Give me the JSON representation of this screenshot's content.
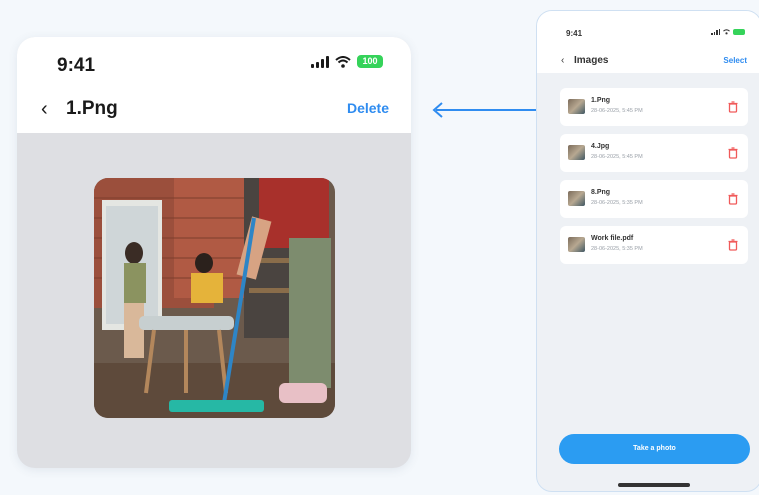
{
  "detail": {
    "time": "9:41",
    "battery_label": "100",
    "back_glyph": "‹",
    "title": "1.Png",
    "delete_label": "Delete"
  },
  "phone": {
    "time": "9:41",
    "back_glyph": "‹",
    "title": "Images",
    "select_label": "Select",
    "items": [
      {
        "name": "1.Png",
        "date": "28-06-2025, 5:45 PM"
      },
      {
        "name": "4.Jpg",
        "date": "28-06-2025, 5:45 PM"
      },
      {
        "name": "8.Png",
        "date": "28-06-2025, 5:35 PM"
      },
      {
        "name": "Work file.pdf",
        "date": "28-06-2025, 5:35 PM"
      }
    ],
    "take_photo_label": "Take a photo"
  },
  "colors": {
    "accent": "#2f8cf0",
    "button": "#2b9cf2",
    "battery": "#35d35a",
    "trash": "#f05a5a"
  },
  "icons": [
    "signal-icon",
    "wifi-icon",
    "battery-icon",
    "back-chevron-icon",
    "arrow-left-icon",
    "trash-icon",
    "image-thumbnail"
  ]
}
